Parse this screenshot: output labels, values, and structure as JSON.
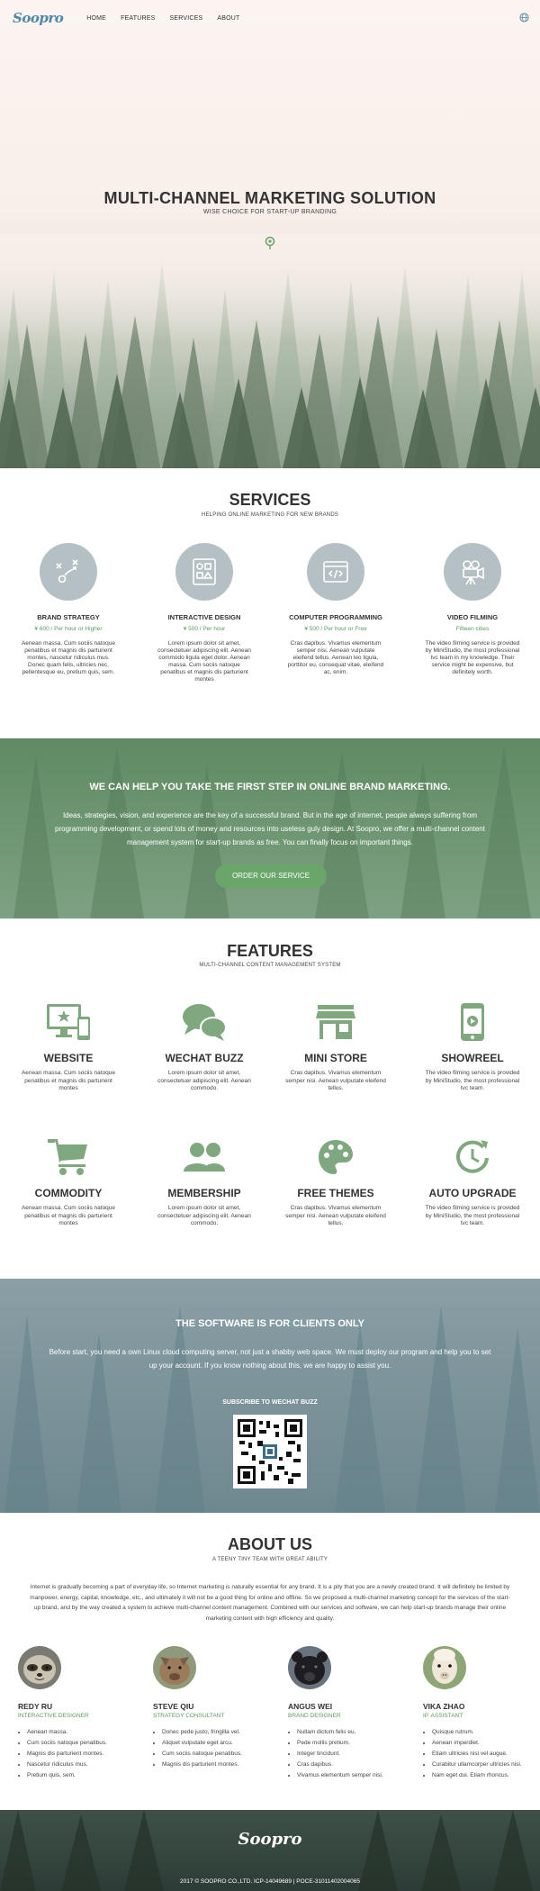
{
  "nav": {
    "logo": "Soopro",
    "links": [
      "HOME",
      "FEATURES",
      "SERVICES",
      "ABOUT"
    ]
  },
  "hero": {
    "title": "MULTI-CHANNEL MARKETING SOLUTION",
    "subtitle": "WISE CHOICE FOR START-UP BRANDING"
  },
  "services": {
    "title": "SERVICES",
    "subtitle": "HELPING ONLINE MARKETING FOR NEW BRANDS",
    "items": [
      {
        "name": "BRAND STRATEGY",
        "price": "¥ 600 / Per hour or Higher",
        "desc": "Aenean massa. Cum sociis natoque penatibus et magnis dis parturient montes, nascetur ridiculus mus. Donec quam felis, ultricies nec, pellentesque eu, pretium quis, sem.",
        "icon": "strategy-icon"
      },
      {
        "name": "INTERACTIVE DESIGN",
        "price": "¥ 500 / Per hour",
        "desc": "Lorem ipsum dolor sit amet, consectetuer adipiscing elit. Aenean commodo ligula eget dolor. Aenean massa. Cum sociis natoque penatibus et magnis dis parturient montes",
        "icon": "design-icon"
      },
      {
        "name": "COMPUTER PROGRAMMING",
        "price": "¥ 500 / Per hour or Free",
        "desc": "Cras dapibus. Vivamus elementum semper nisi. Aenean vulputate eleifend tellus. Aenean leo ligula, porttitor eu, consequat vitae, eleifend ac, enim.",
        "icon": "code-icon"
      },
      {
        "name": "VIDEO FILMING",
        "price": "Fifteen cities",
        "desc": "The video filming service is provided by MiniStudio, the most professional tvc team in my knowledge. Their service might be expensive, but definitely worth.",
        "icon": "camera-icon"
      }
    ]
  },
  "cta": {
    "title": "WE CAN HELP YOU TAKE THE FIRST STEP IN ONLINE BRAND MARKETING.",
    "text": "Ideas, strategies, vision, and experience are the key of a successful brand. But in the age of internet, people always suffering from programming development, or spend lots of money and resources into useless guly design. At Soopro, we offer a multi-channel content management system for start-up brands as free. You can finally focus on important things.",
    "button": "ORDER OUR SERVICE"
  },
  "features": {
    "title": "FEATURES",
    "subtitle": "MULTI-CHANNEL CONTENT MANAGEMENT SYSTEM",
    "items": [
      {
        "name": "WEBSITE",
        "desc": "Aenean massa. Cum sociis natoque penatibus et magnis dis parturient montes",
        "icon": "website-icon"
      },
      {
        "name": "WECHAT BUZZ",
        "desc": "Lorem ipsum dolor sit amet, consectetuer adipiscing elit. Aenean commodo.",
        "icon": "chat-icon"
      },
      {
        "name": "MINI STORE",
        "desc": "Cras dapibus. Vivamus elementum semper nisi. Aenean vulputate eleifend tellus.",
        "icon": "store-icon"
      },
      {
        "name": "SHOWREEL",
        "desc": "The video filming service is provided by MiniStudio, the most professional tvc team.",
        "icon": "phone-video-icon"
      },
      {
        "name": "COMMODITY",
        "desc": "Aenean massa. Cum sociis natoque penatibus et magnis dis parturient montes",
        "icon": "cart-icon"
      },
      {
        "name": "MEMBERSHIP",
        "desc": "Lorem ipsum dolor sit amet, consectetuer adipiscing elit. Aenean commodo.",
        "icon": "members-icon"
      },
      {
        "name": "FREE THEMES",
        "desc": "Cras dapibus. Vivamus elementum semper nisi. Aenean vulputate eleifend tellus.",
        "icon": "palette-icon"
      },
      {
        "name": "AUTO UPGRADE",
        "desc": "The video filming service is provided by MiniStudio, the most professional tvc team.",
        "icon": "upgrade-icon"
      }
    ]
  },
  "software": {
    "title": "THE SOFTWARE IS FOR CLIENTS ONLY",
    "text": "Before start, you need a own Linux cloud computing server, not just a shabby web space. We must deploy our program and help you to set up your account. If you know nothing about this, we are happy to assist you.",
    "subscribe": "SUBSCRIBE TO WECHAT BUZZ"
  },
  "about": {
    "title": "ABOUT US",
    "subtitle": "A TEENY TINY TEAM WITH GREAT ABILITY",
    "text": "Internet is gradually becoming a part of everyday life, so Internet marketing is naturally essential for any brand. It is a pity that you are a newly created brand. It will definitely be limited by manpower, energy, capital, knowledge, etc., and ultimately it will not be a good thing for online and offline. So we proposed a multi-channel marketing concept for the services of the start-up brand, and by the way created a system to achieve multi-channel content management. Combined with our services and software, we can help start-up brands manage their online marketing content with high efficiency and quality.",
    "members": [
      {
        "name": "REDY RU",
        "role": "INTERACTIVE DESIGNER",
        "items": [
          "Aenean massa.",
          "Cum sociis natoque penatibus.",
          "Magnis dis parturient montes.",
          "Nascetur ridiculus mus.",
          "Pretium quis, sem."
        ],
        "avatar": "sloth"
      },
      {
        "name": "STEVE QIU",
        "role": "STRATEGY CONSULTANT",
        "items": [
          "Donec pede justo, fringilla vel.",
          "Aliquet vulputate eget arcu.",
          "Cum sociis natoque penatibus.",
          "Magnis dis parturient montes."
        ],
        "avatar": "boar"
      },
      {
        "name": "ANGUS WEI",
        "role": "BRAND DESIGNER",
        "items": [
          "Nullam dictum felis eu.",
          "Pede mollis pretium.",
          "Integer tincidunt.",
          "Cras dapibus.",
          "Vivamus elementum semper nisi."
        ],
        "avatar": "bear"
      },
      {
        "name": "VIKA ZHAO",
        "role": "IP. ASSISTANT",
        "items": [
          "Quisque rutrum.",
          "Aenean imperdiet.",
          "Etiam ultricies nisi vel augue.",
          "Curabitur ullamcorper ultricies nisi.",
          "Nam eget dui. Etiam rhoncus."
        ],
        "avatar": "alpaca"
      }
    ]
  },
  "footer": {
    "logo": "Soopro",
    "copyright": "2017 © SOOPRO CO.,LTD. ICP-14049689 | POCE-31011402004065"
  },
  "colors": {
    "accent": "#6aa56a",
    "icon_green": "#7fa87f",
    "logo_blue": "#4f88a8",
    "service_circle": "#b5c0c4"
  }
}
